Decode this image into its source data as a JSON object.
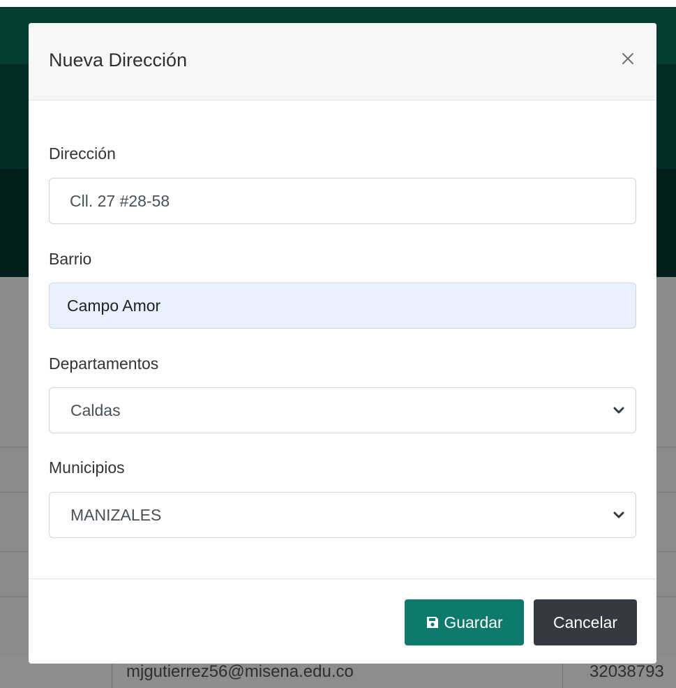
{
  "background": {
    "email": "mjgutierrez56@misena.edu.co",
    "phone": "32038793"
  },
  "modal": {
    "title": "Nueva Dirección",
    "close_icon": "close-icon",
    "fields": {
      "direccion": {
        "label": "Dirección",
        "value": "Cll. 27 #28-58"
      },
      "barrio": {
        "label": "Barrio",
        "value": "Campo Amor"
      },
      "departamentos": {
        "label": "Departamentos",
        "selected": "Caldas"
      },
      "municipios": {
        "label": "Municipios",
        "selected": "MANIZALES"
      }
    },
    "buttons": {
      "save_label": "Guardar",
      "cancel_label": "Cancelar"
    }
  },
  "colors": {
    "primary": "#0e7a6b",
    "dark": "#343a40",
    "autofill": "#e8f0fe"
  }
}
